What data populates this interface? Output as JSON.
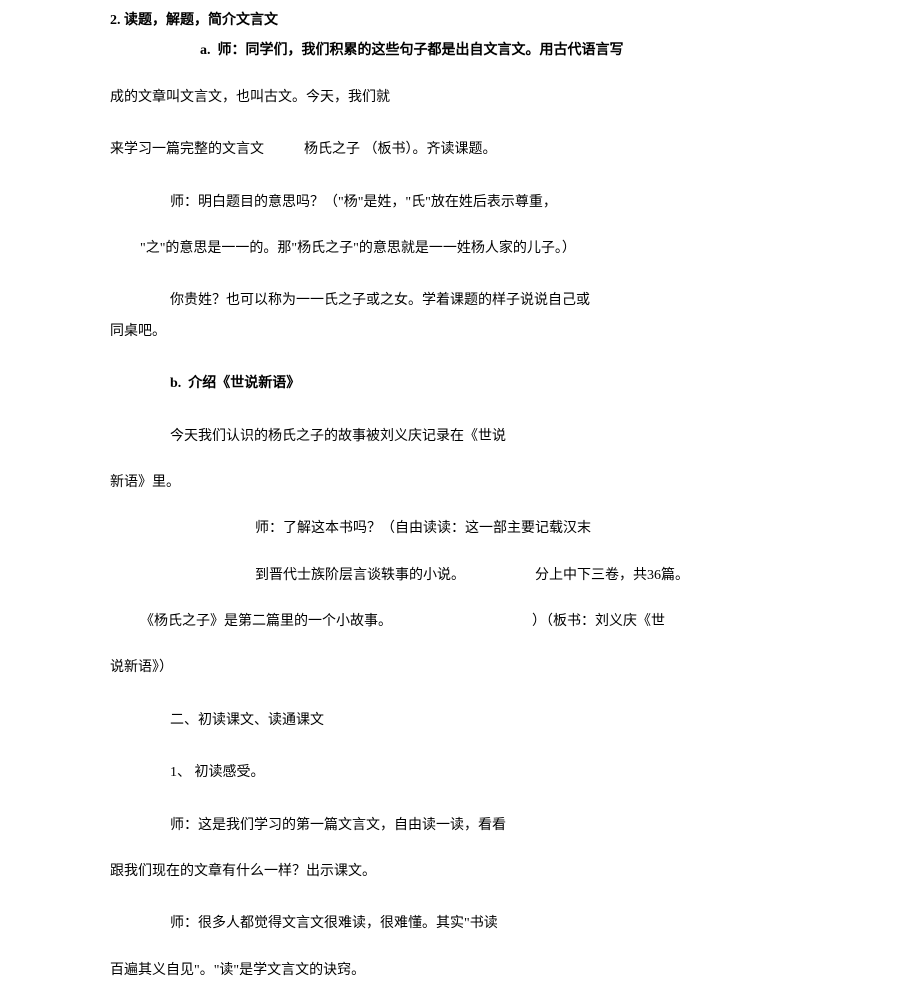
{
  "doc": {
    "l1": "2. 读题，解题，简介文言文",
    "l2": "a.  师：同学们，我们积累的这些句子都是出自文言文。用古代语言写",
    "l3": "成的文章叫文言文，也叫古文。今天，我们就",
    "l4a": "来学习一篇完整的文言文",
    "l4b": "杨氏之子 （板书）。齐读课题。",
    "l5": "师：明白题目的意思吗？（\"杨\"是姓，\"氏\"放在姓后表示尊重，",
    "l6": "\"之\"的意思是一一的。那\"杨氏之子\"的意思就是一一姓杨人家的儿子。）",
    "l7": "你贵姓？也可以称为一一氏之子或之女。学着课题的样子说说自己或",
    "l8": "同桌吧。",
    "l9": "b.  介绍《世说新语》",
    "l10": "今天我们认识的杨氏之子的故事被刘义庆记录在《世说",
    "l11": "新语》里。",
    "l12": "师：了解这本书吗？（自由读读：这一部主要记载汉末",
    "l13a": "到晋代士族阶层言谈轶事的小说。",
    "l13b": "分上中下三卷，共36篇。",
    "l14a": "《杨氏之子》是第二篇里的一个小故事。",
    "l14b": "）（板书：刘义庆《世",
    "l15": "说新语》）",
    "l16": "二、初读课文、读通课文",
    "l17": "1、 初读感受。",
    "l18": "师：这是我们学习的第一篇文言文，自由读一读，看看",
    "l19": "跟我们现在的文章有什么一样？出示课文。",
    "l20": "师：很多人都觉得文言文很难读，很难懂。其实\"书读",
    "l21": "百遍其义自见\"。\"读\"是学文言文的诀窍。"
  }
}
